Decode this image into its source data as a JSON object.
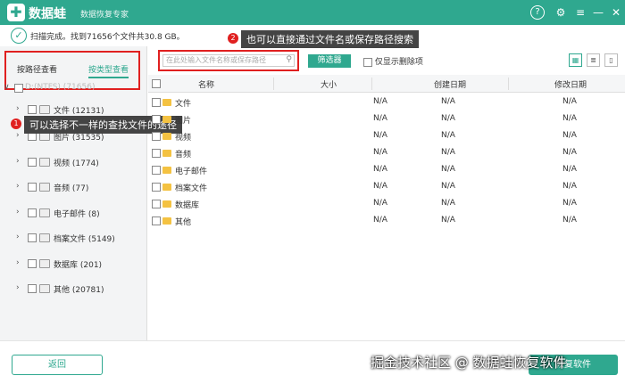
{
  "titlebar": {
    "logo": "✚",
    "app_name": "数据蛙",
    "subtitle": "数据恢复专家",
    "icons": [
      "help-icon",
      "gear-icon",
      "menu-icon",
      "minimize-icon",
      "close-icon"
    ]
  },
  "status": {
    "text": "扫描完成。找到71656个文件共30.8 GB。"
  },
  "annotations": {
    "callout1_badge": "1",
    "callout1_text": "可以选择不一样的查找文件的途径",
    "callout2_badge": "2",
    "callout2_text": "也可以直接通过文件名或保存路径搜索"
  },
  "view_tabs": {
    "by_path": "按路径查看",
    "by_type": "按类型查看"
  },
  "tree": {
    "root": "D:(NTFS) (71656)",
    "items": [
      {
        "label": "文件 (12131)"
      },
      {
        "label": "图片 (31535)"
      },
      {
        "label": "视频 (1774)"
      },
      {
        "label": "音频 (77)"
      },
      {
        "label": "电子邮件 (8)"
      },
      {
        "label": "档案文件 (5149)"
      },
      {
        "label": "数据库 (201)"
      },
      {
        "label": "其他 (20781)"
      }
    ]
  },
  "search": {
    "placeholder": "在此处输入文件名称或保存路径"
  },
  "toolbar": {
    "filter_label": "筛选器",
    "deleted_only_label": "仅显示删除项"
  },
  "grid": {
    "columns": [
      "名称",
      "大小",
      "创建日期",
      "修改日期"
    ],
    "rows": [
      {
        "name": "文件",
        "size": "N/A",
        "created": "N/A",
        "modified": "N/A"
      },
      {
        "name": "图片",
        "size": "N/A",
        "created": "N/A",
        "modified": "N/A"
      },
      {
        "name": "视频",
        "size": "N/A",
        "created": "N/A",
        "modified": "N/A"
      },
      {
        "name": "音频",
        "size": "N/A",
        "created": "N/A",
        "modified": "N/A"
      },
      {
        "name": "电子邮件",
        "size": "N/A",
        "created": "N/A",
        "modified": "N/A"
      },
      {
        "name": "档案文件",
        "size": "N/A",
        "created": "N/A",
        "modified": "N/A"
      },
      {
        "name": "数据库",
        "size": "N/A",
        "created": "N/A",
        "modified": "N/A"
      },
      {
        "name": "其他",
        "size": "N/A",
        "created": "N/A",
        "modified": "N/A"
      }
    ]
  },
  "footer": {
    "back_label": "返回",
    "recover_label": "恢复软件",
    "watermark": "掘金技术社区 @ 数据蛙恢复软件"
  },
  "colors": {
    "accent": "#2fa88f",
    "highlight": "#e02020"
  }
}
